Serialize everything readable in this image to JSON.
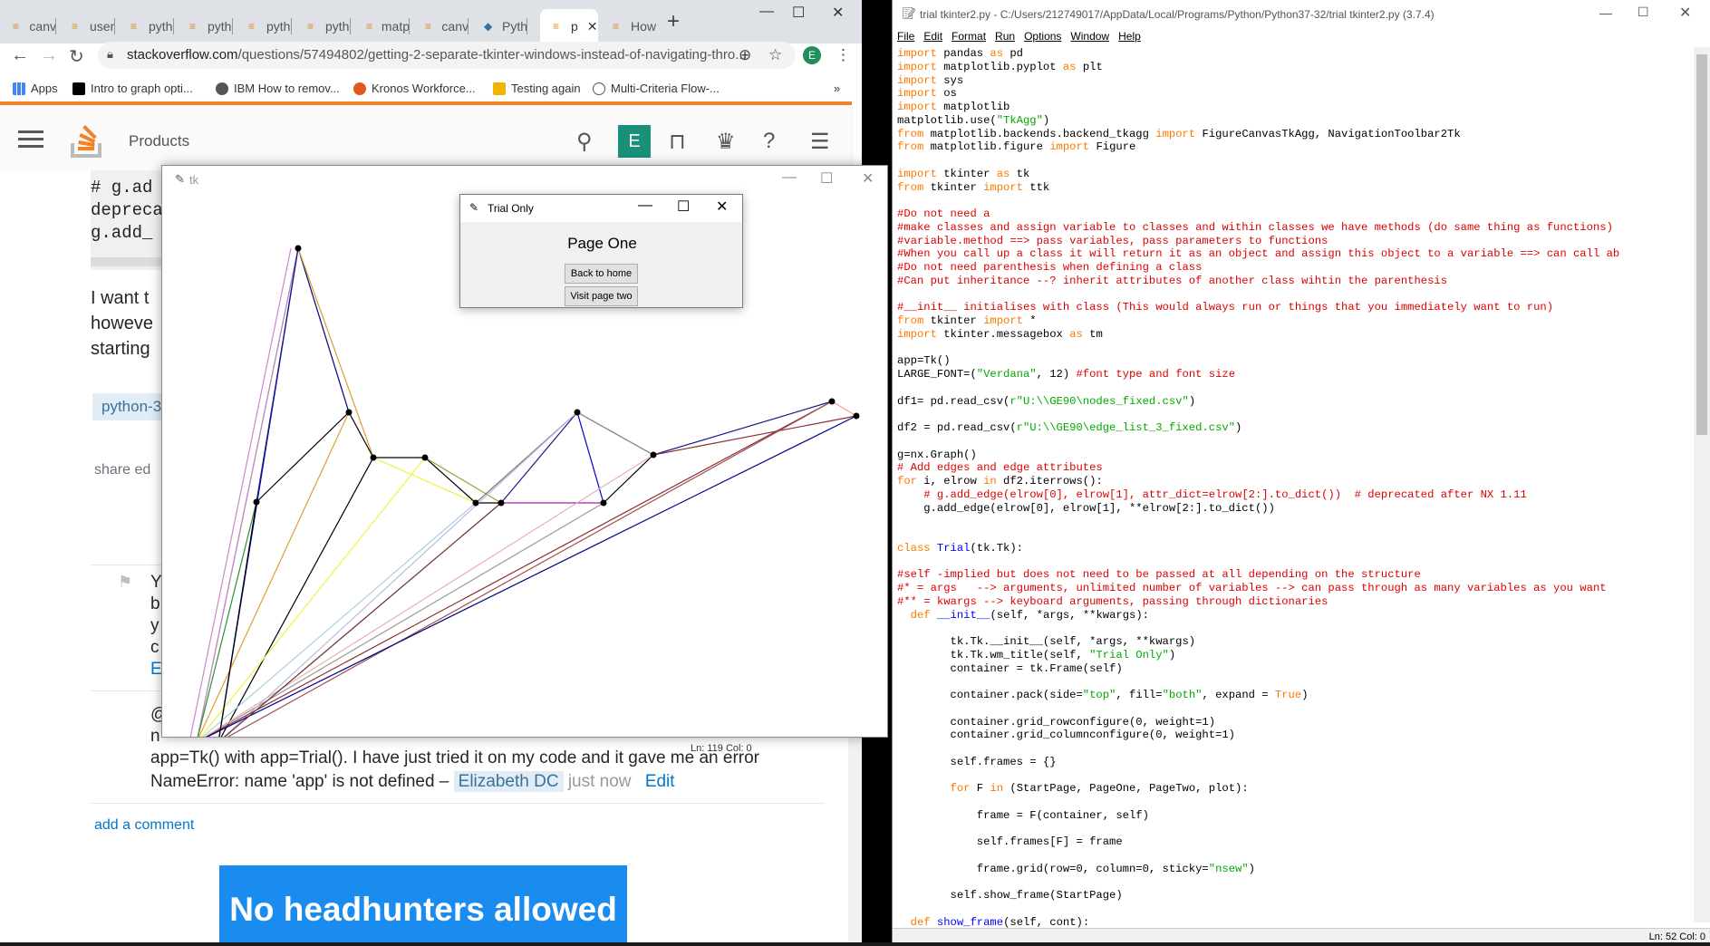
{
  "chrome": {
    "tabs": [
      {
        "label": "canv"
      },
      {
        "label": "user"
      },
      {
        "label": "pyth"
      },
      {
        "label": "pyth"
      },
      {
        "label": "pyth"
      },
      {
        "label": "pyth"
      },
      {
        "label": "matp"
      },
      {
        "label": "canv"
      },
      {
        "label": "Pyth"
      },
      {
        "label": "p"
      },
      {
        "label": "How"
      }
    ],
    "url_domain": "stackoverflow.com",
    "url_path": "/questions/57494802/getting-2-separate-tkinter-windows-instead-of-navigating-thro...",
    "avatar_letter": "E",
    "bookmarks": [
      {
        "label": "Apps"
      },
      {
        "label": "Intro to graph opti..."
      },
      {
        "label": "IBM How to remov..."
      },
      {
        "label": "Kronos Workforce..."
      },
      {
        "label": "Testing again"
      },
      {
        "label": "Multi-Criteria Flow-..."
      }
    ]
  },
  "so": {
    "products": "Products",
    "user_letter": "E",
    "code_lines": [
      "# g.ad",
      "depreca",
      "g.add_"
    ],
    "question_lines": [
      "I want t",
      "howeve",
      "starting"
    ],
    "tag": "python-3",
    "share": "share  ed",
    "answer_lines": [
      "Y",
      "b",
      "y",
      "c",
      "E"
    ],
    "comment_line1": "@",
    "comment_line2a": "n",
    "comment_line3": "app=Tk() with app=Trial(). I have just tried it on my code and it gave me an error",
    "comment_line4": "NameError: name 'app' is not defined –",
    "comment_user": "Elizabeth DC",
    "comment_time": "just now",
    "comment_edit": "Edit",
    "add_comment": "add a comment",
    "ad_text": "No headhunters allowed"
  },
  "tk_window": {
    "title": "tk",
    "status": "Ln: 119  Col: 0"
  },
  "trial_window": {
    "title": "Trial Only",
    "heading": "Page One",
    "btn_home": "Back to home",
    "btn_two": "Visit page two"
  },
  "idle": {
    "title": "trial tkinter2.py - C:/Users/212749017/AppData/Local/Programs/Python/Python37-32/trial tkinter2.py (3.7.4)",
    "menu": [
      "File",
      "Edit",
      "Format",
      "Run",
      "Options",
      "Window",
      "Help"
    ],
    "status": "Ln: 52  Col: 0"
  }
}
